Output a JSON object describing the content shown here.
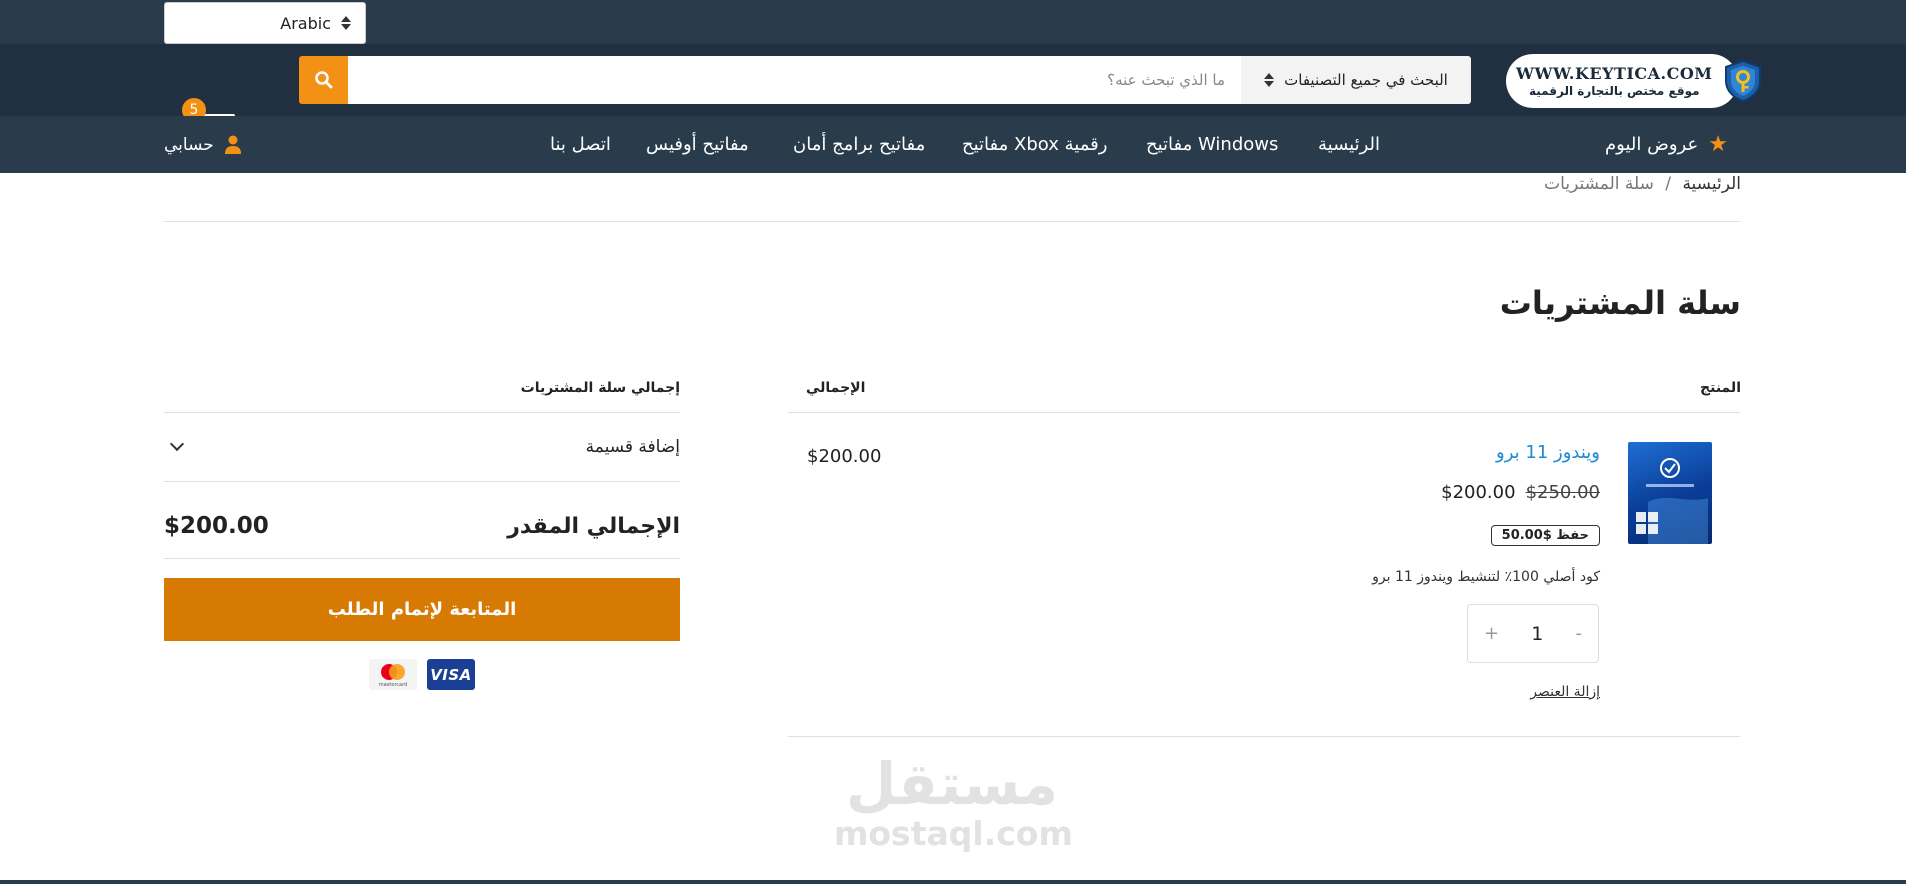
{
  "topbar": {
    "language": "Arabic"
  },
  "logo": {
    "url_text": "WWW.KEYTICA.COM",
    "tagline": "موقع مختص بالتجارة الرقمية"
  },
  "search": {
    "category": "البحث في جميع التصنيفات",
    "placeholder": "ما الذي تبحث عنه؟"
  },
  "cart": {
    "count": "5"
  },
  "nav": {
    "deals": "عروض اليوم",
    "items": [
      "الرئيسية",
      "مفاتيح Windows",
      "مفاتيح Xbox رقمية",
      "مفاتيح برامج أمان",
      "مفاتيح أوفيس",
      "اتصل بنا"
    ],
    "account": "حسابي"
  },
  "breadcrumb": {
    "home": "الرئيسية",
    "separator": "/",
    "current": "سلة المشتريات"
  },
  "page_title": "سلة المشتريات",
  "table": {
    "product_header": "المنتج",
    "total_header": "الإجمالي"
  },
  "item": {
    "name": "ويندوز 11 برو",
    "old_price": "$250.00",
    "price": "$200.00",
    "save": "حفظ $50.00",
    "description": "كود أصلي 100٪ لتنشيط ويندوز 11 برو",
    "qty": "1",
    "qty_minus": "-",
    "qty_plus": "+",
    "remove": "إزالة العنصر",
    "line_total": "$200.00"
  },
  "summary": {
    "title": "إجمالي سلة المشتريات",
    "coupon": "إضافة قسيمة",
    "total_label": "الإجمالي المقدر",
    "total_value": "$200.00",
    "checkout": "المتابعة لإتمام الطلب"
  },
  "payment": {
    "visa": "VISA",
    "mastercard": "mastercard"
  },
  "watermark": {
    "ar": "مستقل",
    "en": "mostaql.com"
  },
  "colors": {
    "accent": "#f29113",
    "checkout": "#d77a03",
    "nav_bg": "#2a3b4c",
    "header_bg": "#213040",
    "link": "#1c8ad6"
  }
}
